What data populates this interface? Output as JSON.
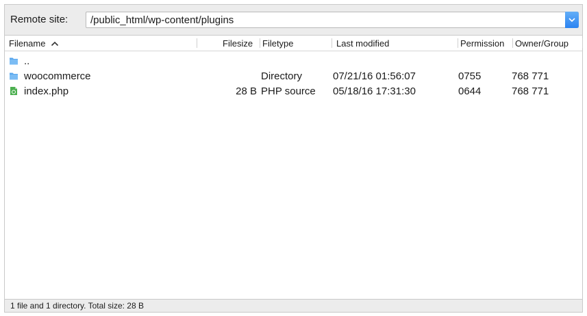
{
  "remote_bar": {
    "label": "Remote site:",
    "path": "/public_html/wp-content/plugins"
  },
  "columns": {
    "filename": "Filename",
    "filesize": "Filesize",
    "filetype": "Filetype",
    "last_modified": "Last modified",
    "permissions": "Permission",
    "owner_group": "Owner/Group"
  },
  "sort": {
    "column": "filename",
    "direction": "ascending",
    "indicator_icon": "chevron-up-icon"
  },
  "rows": [
    {
      "icon": "folder-icon",
      "filename": "..",
      "filesize": "",
      "filetype": "",
      "last_modified": "",
      "permissions": "",
      "owner_group": ""
    },
    {
      "icon": "folder-icon",
      "filename": "woocommerce",
      "filesize": "",
      "filetype": "Directory",
      "last_modified": "07/21/16 01:56:07",
      "permissions": "0755",
      "owner_group": "768 771"
    },
    {
      "icon": "php-file-icon",
      "filename": "index.php",
      "filesize": "28 B",
      "filetype": "PHP source",
      "last_modified": "05/18/16 17:31:30",
      "permissions": "0644",
      "owner_group": "768 771"
    }
  ],
  "status": {
    "text": "1 file and 1 directory. Total size: 28 B"
  },
  "colors": {
    "accent": "#2b83f1",
    "folder": "#5aa7ee",
    "php_file": "#4caf50"
  }
}
